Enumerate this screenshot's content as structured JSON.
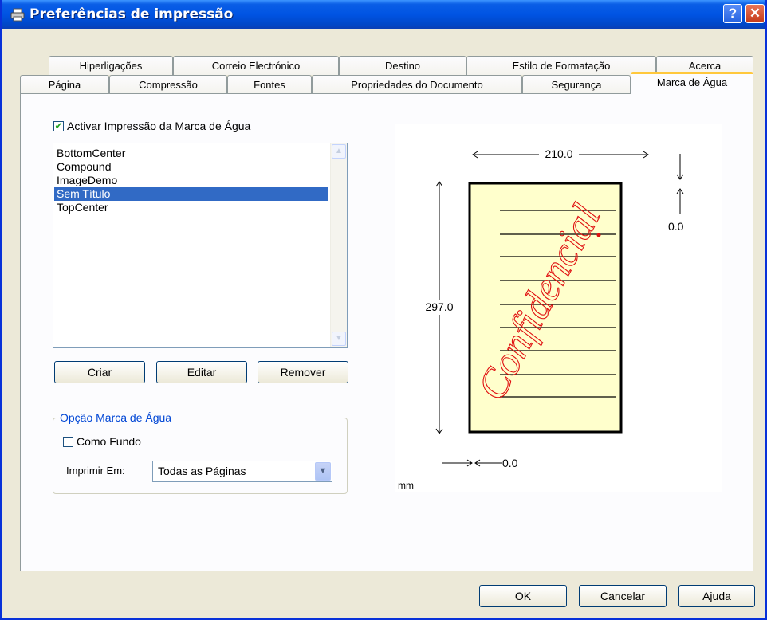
{
  "window": {
    "title": "Preferências de impressão",
    "help_button": "?",
    "close_button": "✕"
  },
  "tabs": {
    "row1": [
      "Hiperligações",
      "Correio Electrónico",
      "Destino",
      "Estilo de Formatação",
      "Acerca"
    ],
    "row2": [
      "Página",
      "Compressão",
      "Fontes",
      "Propriedades do Documento",
      "Segurança",
      "Marca de Água"
    ],
    "active": "Marca de Água"
  },
  "watermark": {
    "enable_label": "Activar Impressão da Marca de Água",
    "enable_checked": true,
    "list": {
      "items": [
        "BottomCenter",
        "Compound",
        "ImageDemo",
        "Sem Título",
        "TopCenter"
      ],
      "selected": "Sem Título"
    },
    "buttons": {
      "create": "Criar",
      "edit": "Editar",
      "remove": "Remover"
    }
  },
  "options": {
    "group_label": "Opção Marca de Água",
    "background_label": "Como Fundo",
    "background_checked": false,
    "print_on_label": "Imprimir Em:",
    "print_on_value": "Todas as Páginas"
  },
  "preview": {
    "width": "210.0",
    "height": "297.0",
    "offset_x": "0.0",
    "offset_y": "0.0",
    "unit": "mm",
    "watermark_text": "Confidencial",
    "watermark_color": "#e01010",
    "page_color": "#ffffcc"
  },
  "footer": {
    "ok": "OK",
    "cancel": "Cancelar",
    "help": "Ajuda"
  }
}
